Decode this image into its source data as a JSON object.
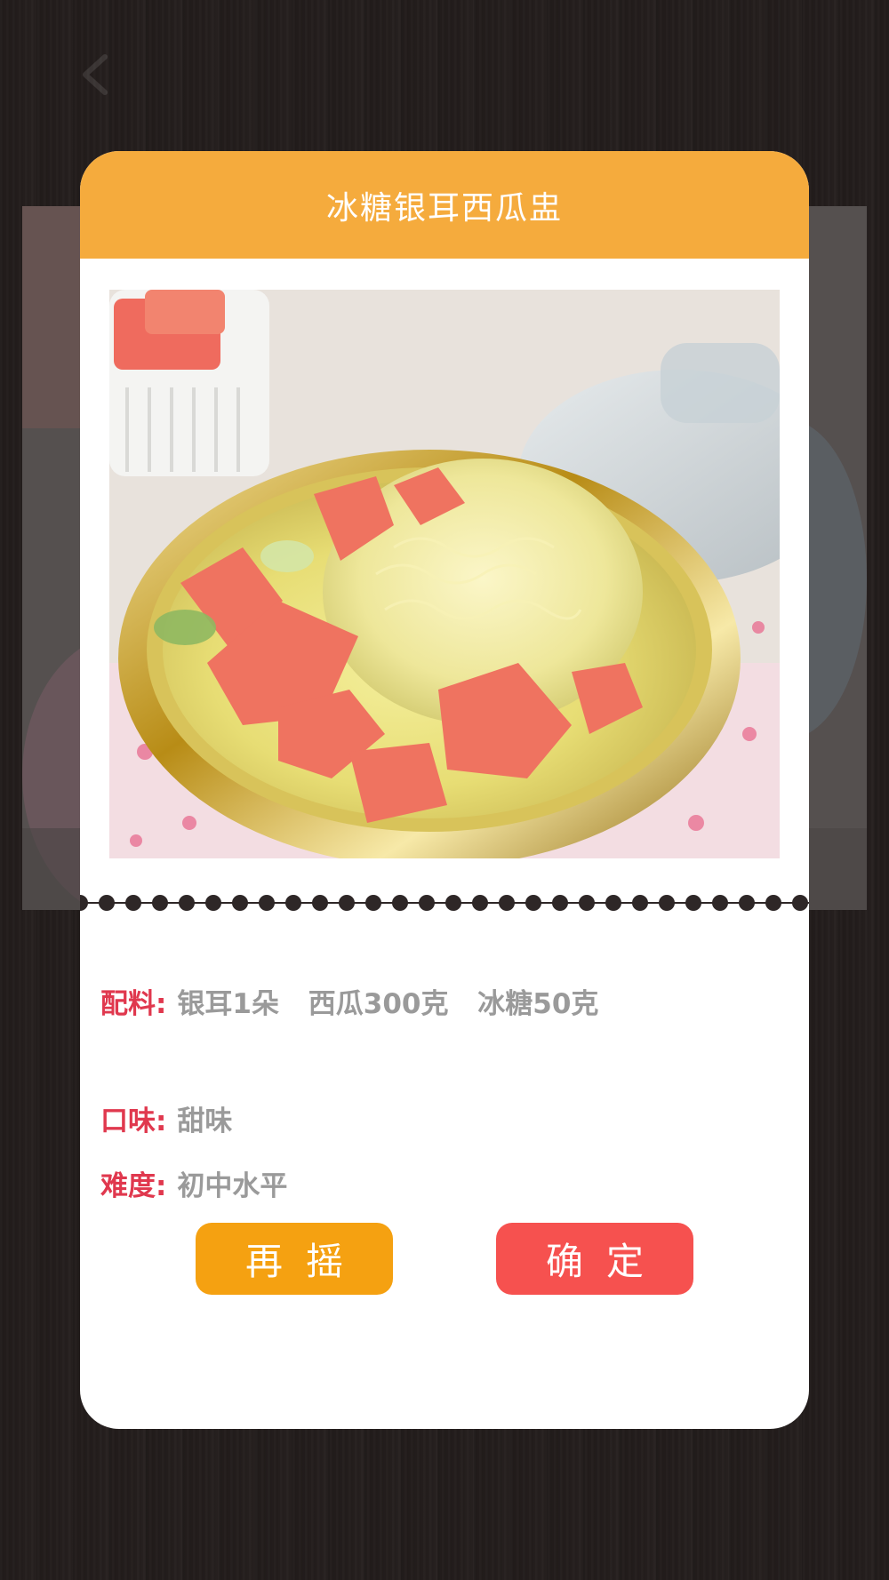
{
  "recipe": {
    "title": "冰糖银耳西瓜盅",
    "image_icon": "dessert-photo",
    "ingredients_label": "配料:",
    "ingredients": [
      "银耳1朵",
      "西瓜300克",
      "冰糖50克"
    ],
    "taste_label": "口味:",
    "taste": "甜味",
    "difficulty_label": "难度:",
    "difficulty": "初中水平"
  },
  "actions": {
    "reshake_label": "再摇",
    "confirm_label": "确定"
  },
  "colors": {
    "header": "#f5ab3d",
    "label": "#e0384e",
    "reshake_button": "#f5a111",
    "confirm_button": "#f6514f",
    "background": "#231d1c"
  },
  "icons": {
    "back": "back-arrow-icon"
  }
}
